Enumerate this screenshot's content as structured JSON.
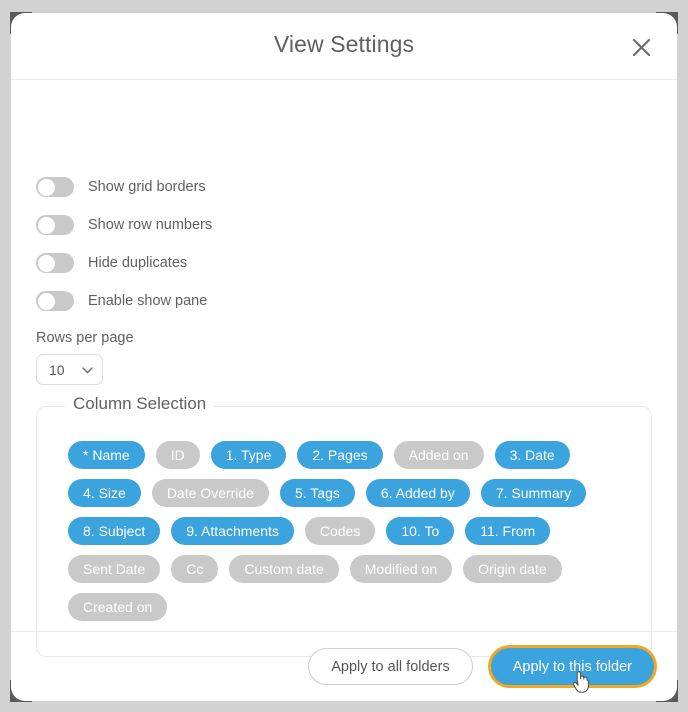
{
  "dialog": {
    "title": "View Settings",
    "close_icon": "close-icon"
  },
  "toggles": [
    {
      "label": "Show grid borders",
      "on": false
    },
    {
      "label": "Show row numbers",
      "on": false
    },
    {
      "label": "Hide duplicates",
      "on": false
    },
    {
      "label": "Enable show pane",
      "on": false
    }
  ],
  "rows_per_page": {
    "label": "Rows per page",
    "value": "10",
    "chevron_icon": "chevron-down-icon"
  },
  "column_selection": {
    "legend": "Column Selection",
    "chips": [
      {
        "label": "* Name",
        "selected": true
      },
      {
        "label": "ID",
        "selected": false
      },
      {
        "label": "1. Type",
        "selected": true
      },
      {
        "label": "2. Pages",
        "selected": true
      },
      {
        "label": "Added on",
        "selected": false
      },
      {
        "label": "3. Date",
        "selected": true
      },
      {
        "label": "4. Size",
        "selected": true
      },
      {
        "label": "Date Override",
        "selected": false
      },
      {
        "label": "5. Tags",
        "selected": true
      },
      {
        "label": "6. Added by",
        "selected": true
      },
      {
        "label": "7. Summary",
        "selected": true
      },
      {
        "label": "8. Subject",
        "selected": true
      },
      {
        "label": "9. Attachments",
        "selected": true
      },
      {
        "label": "Codes",
        "selected": false
      },
      {
        "label": "10. To",
        "selected": true
      },
      {
        "label": "11. From",
        "selected": true
      },
      {
        "label": "Sent Date",
        "selected": false
      },
      {
        "label": "Cc",
        "selected": false
      },
      {
        "label": "Custom date",
        "selected": false
      },
      {
        "label": "Modified on",
        "selected": false
      },
      {
        "label": "Origin date",
        "selected": false
      },
      {
        "label": "Created on",
        "selected": false
      }
    ]
  },
  "footer": {
    "apply_all_label": "Apply to all folders",
    "apply_this_label": "Apply to this folder",
    "focused_button": "apply-this-folder-button"
  },
  "colors": {
    "accent_blue": "#3ba3dd",
    "chip_unselected_gray": "#c9c9c9",
    "focus_ring_orange": "#f5a623",
    "text_gray": "#5f6061",
    "frame_gray": "#d2d2d2"
  }
}
